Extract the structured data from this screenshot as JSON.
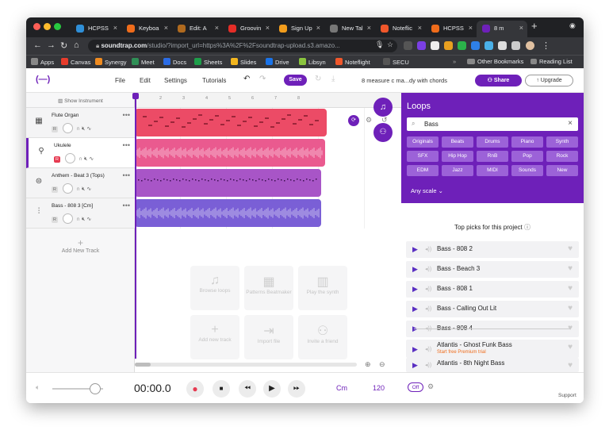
{
  "browser": {
    "tabs": [
      {
        "label": "HCPSS",
        "color": "#2f8fd8"
      },
      {
        "label": "Keyboa",
        "color": "#ef6c1b"
      },
      {
        "label": "Edit: A",
        "color": "#b06a1e"
      },
      {
        "label": "Groovin",
        "color": "#e52d27"
      },
      {
        "label": "Sign Up",
        "color": "#f29d1c"
      },
      {
        "label": "New Tal",
        "color": "#777777"
      },
      {
        "label": "Noteflic",
        "color": "#f0572b"
      },
      {
        "label": "HCPSS",
        "color": "#ef6c1b"
      },
      {
        "label": "8 m",
        "color": "#6e20b9"
      }
    ],
    "url_host": "soundtrap.com",
    "url_path": "/studio/?import_url=https%3A%2F%2Fsoundtrap-upload.s3.amazo...",
    "bookmarks": [
      "Apps",
      "Canvas",
      "Synergy",
      "Meet",
      "Docs",
      "Sheets",
      "Slides",
      "Drive",
      "Libsyn",
      "Noteflight",
      "SECU"
    ],
    "other_bookmarks": "Other Bookmarks",
    "reading_list": "Reading List"
  },
  "app": {
    "logo": "(—)",
    "menu": [
      "File",
      "Edit",
      "Settings",
      "Tutorials"
    ],
    "save": "Save",
    "project": "8 measure c ma...dy with chords",
    "share": "Share",
    "upgrade": "Upgrade"
  },
  "sidebar": {
    "show_instrument": "Show Instrument",
    "tracks": [
      {
        "name": "Flute Organ",
        "icon": "keyboard-icon",
        "armed": false
      },
      {
        "name": "Ukulele",
        "icon": "guitar-icon",
        "armed": true
      },
      {
        "name": "Anthem - Beat 3 (Tops)",
        "icon": "drum-icon",
        "armed": false
      },
      {
        "name": "Bass - 808 3 [Cm]",
        "icon": "waveform-icon",
        "armed": false
      }
    ],
    "add_track": "Add New Track",
    "r_label": "R"
  },
  "timeline": {
    "ruler": [
      "2",
      "3",
      "4",
      "5",
      "6",
      "7",
      "8"
    ],
    "clip_colors": [
      "#ec4b66",
      "#ea5a8f",
      "#a855c7",
      "#7a5fd6"
    ]
  },
  "empty_actions": [
    {
      "label": "Browse loops",
      "icon": "♫"
    },
    {
      "label": "Patterns Beatmaker",
      "icon": "▦"
    },
    {
      "label": "Play the synth",
      "icon": "▥"
    },
    {
      "label": "Add new track",
      "icon": "+"
    },
    {
      "label": "Import file",
      "icon": "⇥"
    },
    {
      "label": "Invite a friend",
      "icon": "⚇"
    }
  ],
  "loops": {
    "title": "Loops",
    "search": "Bass",
    "filters": [
      [
        "Originals",
        "Beats",
        "Drums",
        "Piano",
        "Synth"
      ],
      [
        "SFX",
        "Hip Hop",
        "RnB",
        "Pop",
        "Rock"
      ],
      [
        "EDM",
        "Jazz",
        "MIDI",
        "Sounds",
        "New"
      ]
    ],
    "scale": "Any scale",
    "top_picks": "Top picks for this project",
    "picks": [
      "Bass - 808 2",
      "Bass - Beach 3",
      "Bass - 808 1",
      "Bass - Calling Out Lit",
      "Bass - 808 4"
    ],
    "more": [
      {
        "name": "Atlantis - Ghost Funk Bass",
        "note": "Start free Premium trial"
      },
      {
        "name": "Atlantis - 8th Night Bass",
        "note": ""
      }
    ]
  },
  "transport": {
    "time": "00:00.0",
    "key": "Cm",
    "tempo": "120",
    "metronome": "Off",
    "support": "Support"
  },
  "colors": {
    "accent": "#6e20b9",
    "record": "#e63950"
  }
}
